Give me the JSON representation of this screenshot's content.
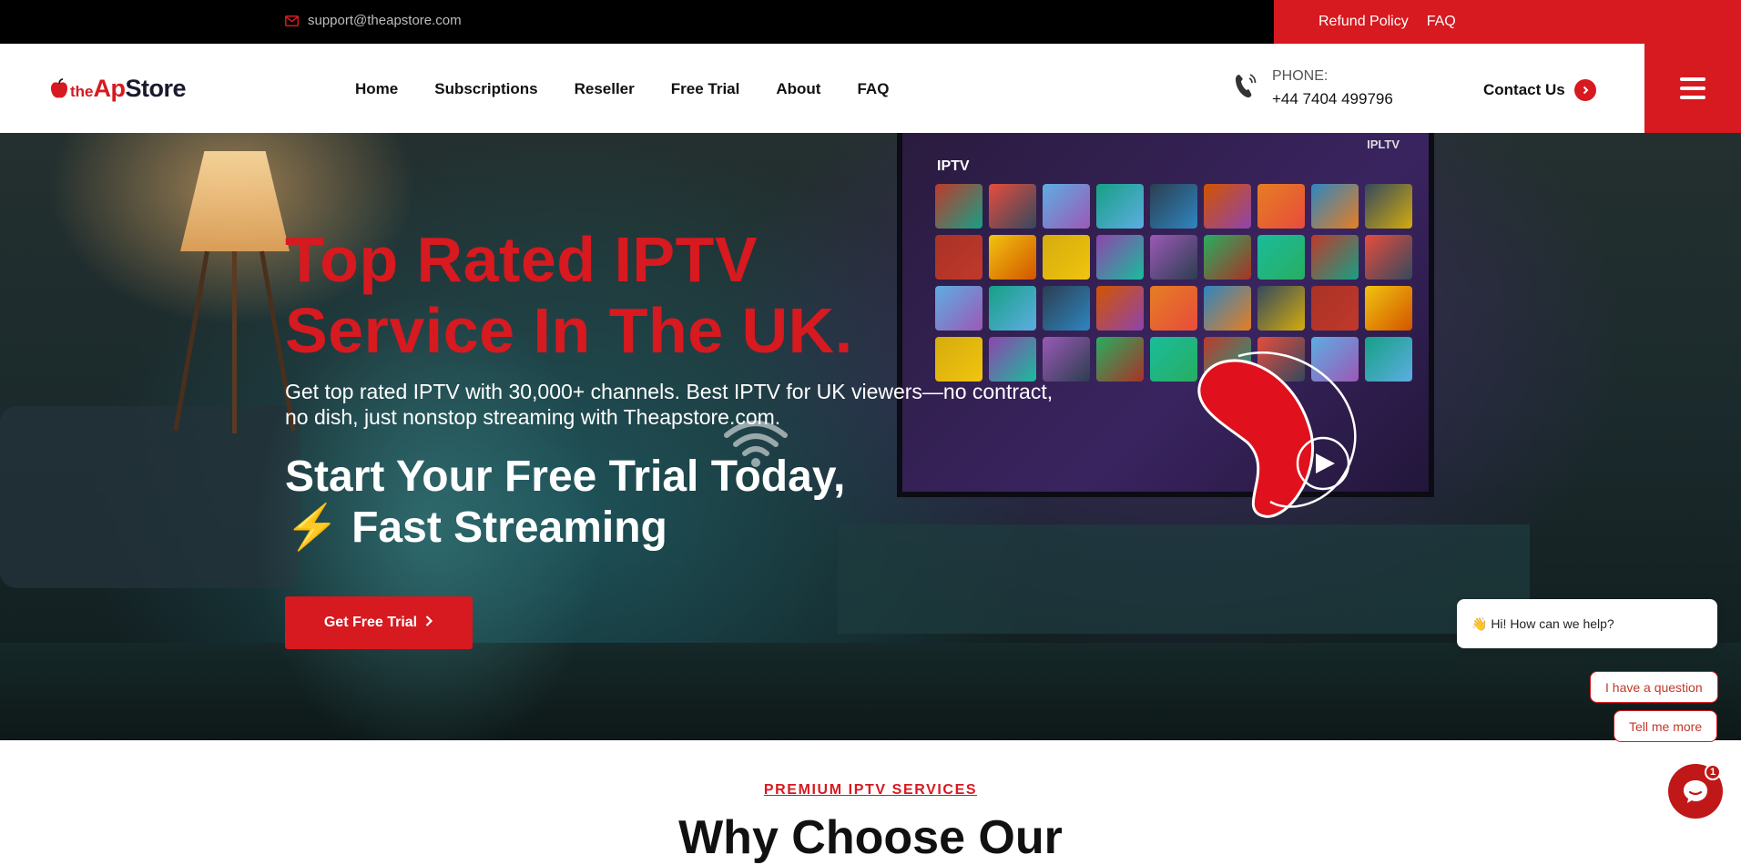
{
  "topbar": {
    "email": "support@theapstore.com",
    "links": [
      "Refund Policy",
      "FAQ"
    ]
  },
  "brand": {
    "logo_prefix": "the",
    "logo_ap": "Ap",
    "logo_store": "Store"
  },
  "nav": {
    "items": [
      "Home",
      "Subscriptions",
      "Reseller",
      "Free Trial",
      "About",
      "FAQ"
    ]
  },
  "phone": {
    "label": "PHONE:",
    "number": "+44 7404 499796"
  },
  "contact": {
    "label": "Contact Us"
  },
  "hero": {
    "title_line1": "Top Rated IPTV",
    "title_line2": "Service In The UK.",
    "subtitle": "Get top rated IPTV with 30,000+ channels. Best IPTV for UK viewers—no contract, no dish, just nonstop streaming with Theapstore.com.",
    "cta_line1": "Start Your Free Trial Today,",
    "cta_line2": "⚡ Fast Streaming",
    "button_label": "Get Free Trial",
    "tv_label": "IPTV",
    "tv_label_corner": "IPLTV"
  },
  "chat": {
    "greeting": "👋 Hi! How can we help?",
    "options": [
      "I have a question",
      "Tell me more"
    ],
    "badge_count": "1"
  },
  "section": {
    "eyebrow": "PREMIUM IPTV SERVICES",
    "title": "Why Choose Our"
  },
  "colors": {
    "brand_red": "#d71920",
    "topbar_black": "#000000",
    "text_dark": "#111111"
  },
  "icons": [
    "envelope-icon",
    "apple-icon",
    "phone-icon",
    "chevron-right-icon",
    "menu-icon",
    "wifi-icon",
    "play-icon",
    "chat-icon"
  ]
}
